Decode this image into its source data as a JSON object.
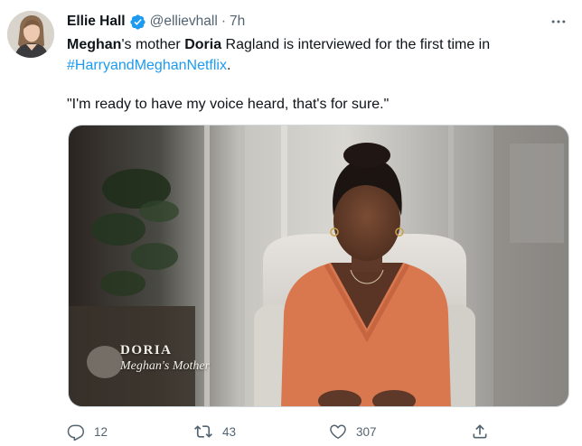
{
  "tweet": {
    "author_name": "Ellie Hall",
    "handle": "@ellievhall",
    "separator": "·",
    "time": "7h",
    "text": {
      "part1": "Meghan",
      "part2": "'s mother ",
      "part3": "Doria",
      "part4": " Ragland is interviewed for the first time in ",
      "hashtag": "#HarryandMeghanNetflix",
      "part5": ".",
      "quote": "\"I'm ready to have my voice heard, that's for sure.\""
    },
    "media": {
      "caption_name": "DORIA",
      "caption_role": "Meghan's Mother"
    },
    "actions": {
      "replies": "12",
      "retweets": "43",
      "likes": "307"
    }
  },
  "colors": {
    "accent": "#1d9bf0",
    "text": "#0f1419",
    "secondary": "#536471"
  },
  "icons": {
    "verified": "verified-badge-icon",
    "more": "more-dots-icon",
    "reply": "reply-icon",
    "retweet": "retweet-icon",
    "like": "heart-icon",
    "share": "share-icon"
  }
}
